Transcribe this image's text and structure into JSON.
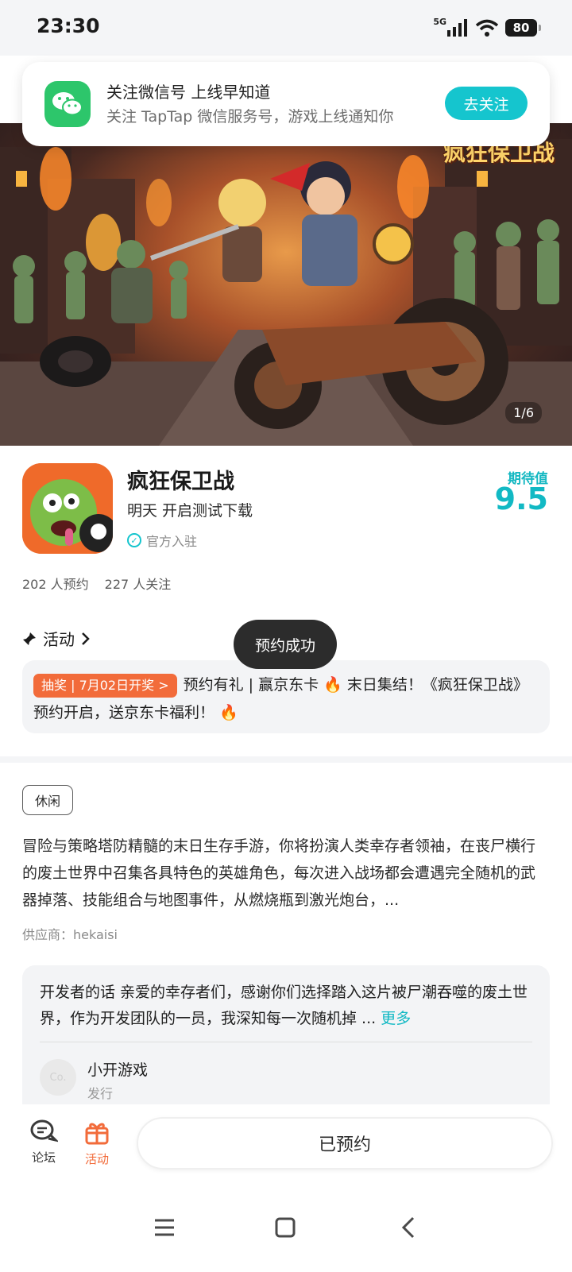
{
  "status_bar": {
    "time": "23:30",
    "network": "5G",
    "battery": "80"
  },
  "notice": {
    "title": "关注微信号 上线早知道",
    "subtitle": "关注 TapTap 微信服务号，游戏上线通知你",
    "follow_label": "去关注"
  },
  "hero": {
    "logo_text": "疯狂保卫战",
    "counter": "1/6"
  },
  "game": {
    "title": "疯狂保卫战",
    "subtitle": "明天 开启测试下载",
    "official_label": "官方入驻",
    "expect_label": "期待值",
    "expect_score": "9.5"
  },
  "stats": {
    "reservations": "202 人预约",
    "followers": "227 人关注"
  },
  "activity": {
    "heading": "活动",
    "tag": "抽奖 | 7月02日开奖 >",
    "text": "预约有礼 | 赢京东卡 🔥 末日集结！《疯狂保卫战》预约开启，送京东卡福利！ 🔥"
  },
  "toast": "预约成功",
  "detail": {
    "genre": "休闲",
    "description": "冒险与策略塔防精髓的末日生存手游，你将扮演人类幸存者领袖，在丧尸横行的废土世界中召集各具特色的英雄角色，每次进入战场都会遭遇完全随机的武器掉落、技能组合与地图事件，从燃烧瓶到激光炮台，...",
    "supplier": "供应商：hekaisi"
  },
  "developer": {
    "text": "开发者的话  亲爱的幸存者们，感谢你们选择踏入这片被尸潮吞噬的废土世界，作为开发团队的一员，我深知每一次随机掉 ...",
    "more_label": "更多",
    "avatar_text": "Co.",
    "name": "小开游戏",
    "role": "发行"
  },
  "bottom": {
    "forum_label": "论坛",
    "activity_label": "活动",
    "reserved_label": "已预约"
  },
  "colors": {
    "accent": "#15c5ce",
    "orange": "#f26b3a",
    "wechat": "#2dc66b"
  }
}
